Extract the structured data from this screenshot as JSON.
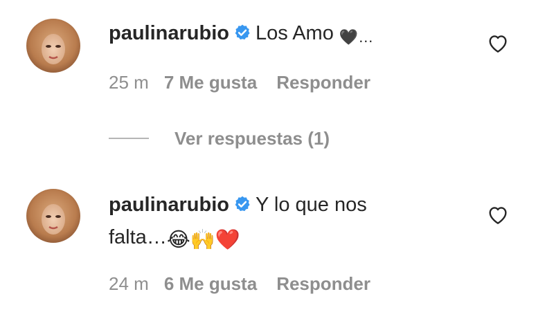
{
  "comments": [
    {
      "username": "paulinarubio",
      "text": "Los Amo",
      "emoji_suffix": "🖤…",
      "time": "25 m",
      "likes": "7 Me gusta",
      "reply": "Responder"
    },
    {
      "username": "paulinarubio",
      "text": "Y lo que nos",
      "text_line2": "falta…",
      "emoji_suffix": "😂🙌❤️",
      "time": "24 m",
      "likes": "6 Me gusta",
      "reply": "Responder"
    }
  ],
  "view_replies": {
    "label": "Ver respuestas (1)"
  },
  "colors": {
    "text": "#262626",
    "secondary": "#8e8e8e",
    "verified": "#3897f0"
  }
}
